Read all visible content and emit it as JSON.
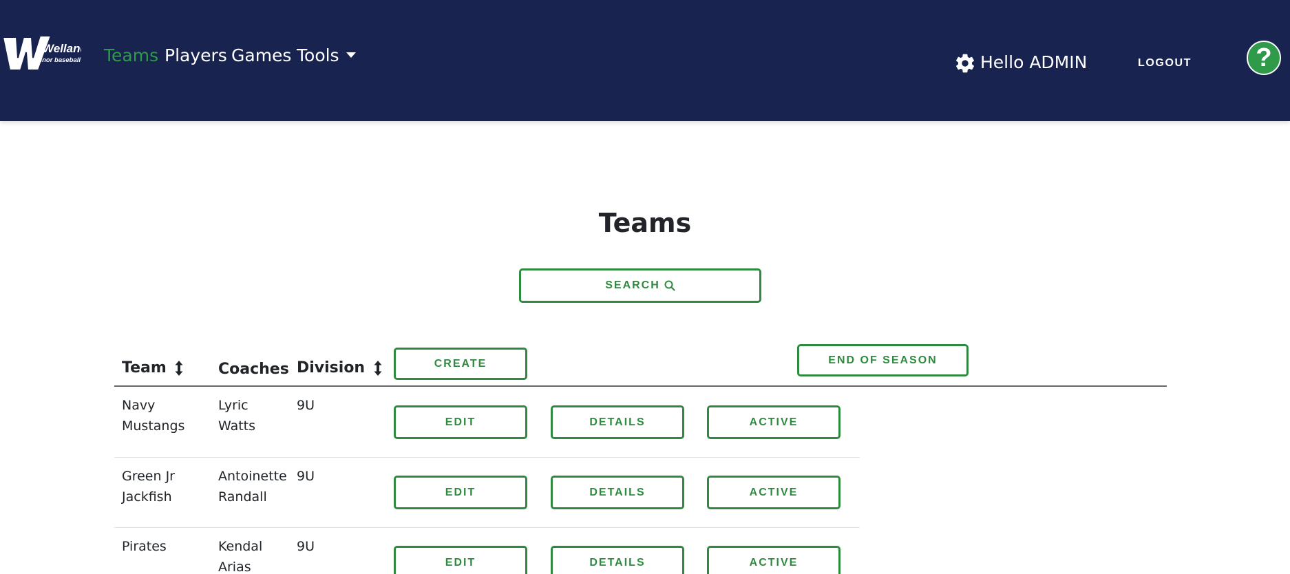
{
  "brand": {
    "logo_text": "Welland",
    "logo_subtext": "minor baseball"
  },
  "nav": {
    "teams": "Teams",
    "players": "Players",
    "games": "Games",
    "tools": "Tools"
  },
  "user": {
    "greeting": "Hello ADMIN",
    "logout": "LOGOUT",
    "help": "?"
  },
  "page": {
    "title": "Teams",
    "search_label": "SEARCH",
    "create_label": "CREATE",
    "end_of_season_label": "END OF SEASON"
  },
  "table": {
    "headers": {
      "team": "Team",
      "coaches": "Coaches",
      "division": "Division"
    },
    "rows": [
      {
        "team_line1": "Navy",
        "team_line2": "Mustangs",
        "coach_line1": "Lyric",
        "coach_line2": "Watts",
        "division": "9U",
        "edit": "EDIT",
        "details": "DETAILS",
        "status": "ACTIVE"
      },
      {
        "team_line1": "Green Jr",
        "team_line2": "Jackfish",
        "coach_line1": "Antoinette",
        "coach_line2": "Randall",
        "division": "9U",
        "edit": "EDIT",
        "details": "DETAILS",
        "status": "ACTIVE"
      },
      {
        "team_line1": "Pirates",
        "team_line2": "",
        "coach_line1": "Kendal",
        "coach_line2": "Arias",
        "division": "9U",
        "edit": "EDIT",
        "details": "DETAILS",
        "status": "ACTIVE"
      }
    ]
  },
  "colors": {
    "navbar": "#18244f",
    "accent_green": "#2d8a3e",
    "active_link": "#2e9a4a"
  },
  "icons": [
    "gear-icon",
    "help-icon",
    "search-icon",
    "sort-icon",
    "caret-down-icon"
  ]
}
